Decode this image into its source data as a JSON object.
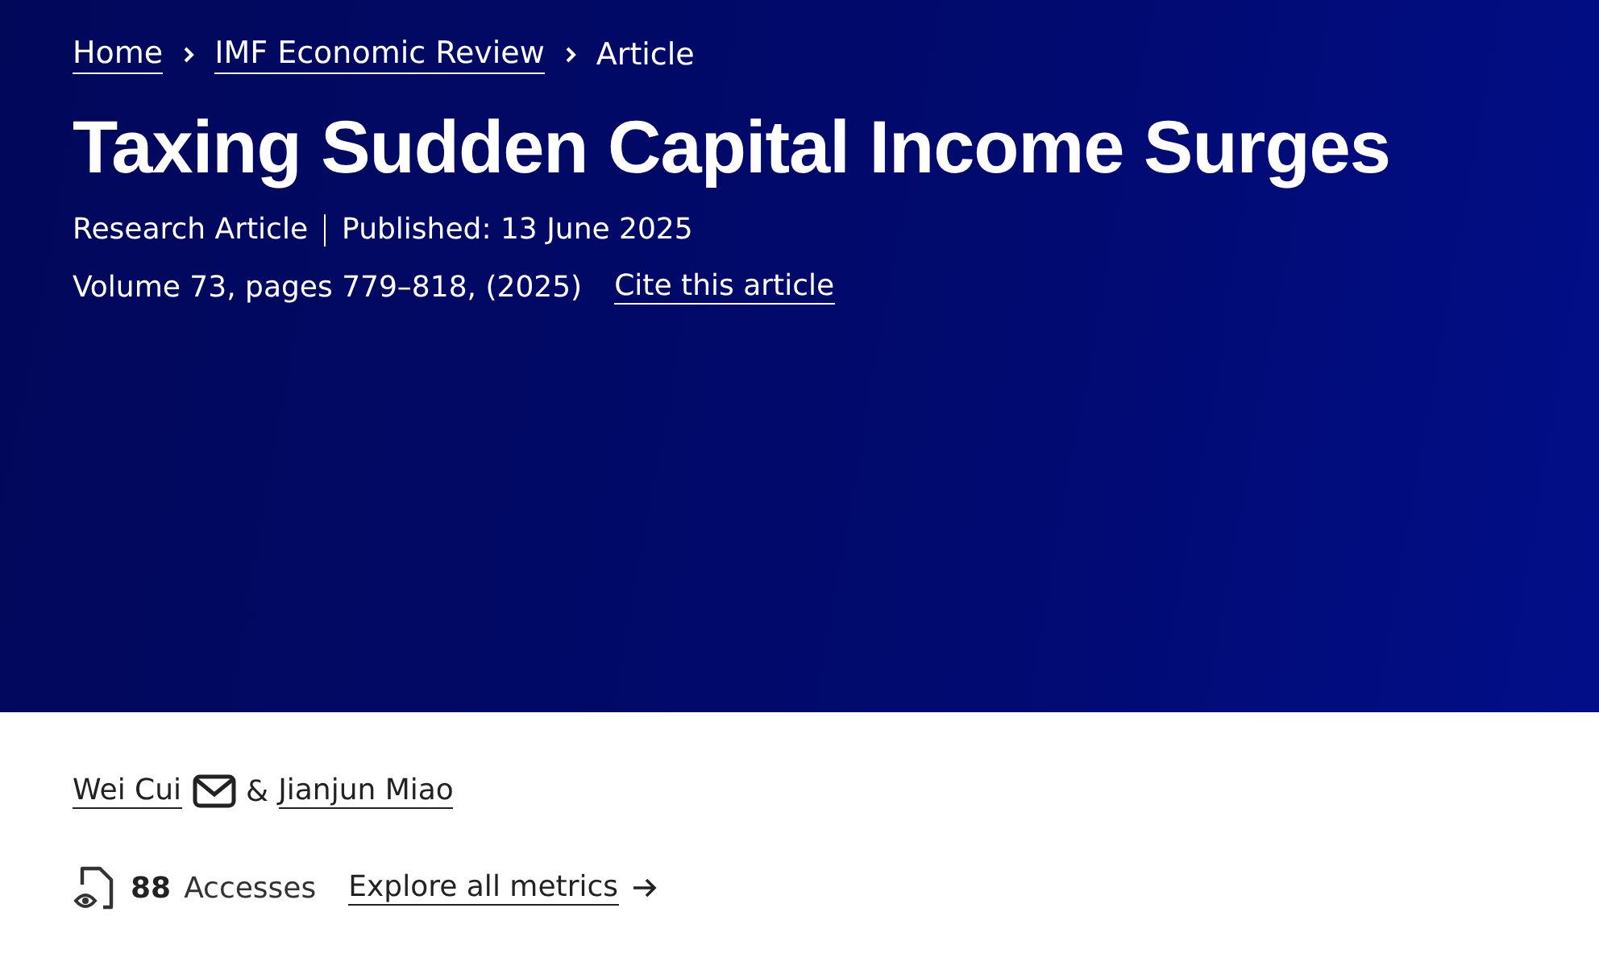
{
  "breadcrumb": [
    {
      "label": "Home",
      "current": false
    },
    {
      "label": "IMF Economic Review",
      "current": false
    },
    {
      "label": "Article",
      "current": true
    }
  ],
  "title": "Taxing Sudden Capital Income Surges",
  "meta": {
    "type": "Research Article",
    "published": "Published: 13 June 2025",
    "citation": "Volume 73, pages 779–818, (2025)",
    "cite_link": "Cite this article"
  },
  "authors": [
    {
      "name": "Wei Cui",
      "email": true
    },
    {
      "name": "Jianjun Miao",
      "email": false
    }
  ],
  "author_separator": "&",
  "metrics": {
    "count": "88",
    "label": "Accesses",
    "link": "Explore all metrics"
  }
}
